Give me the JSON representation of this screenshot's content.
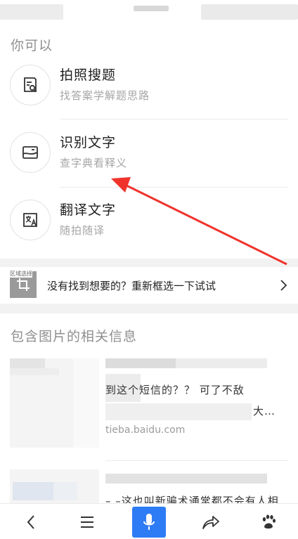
{
  "section_you_can": "你可以",
  "options": [
    {
      "title": "拍照搜题",
      "subtitle": "找答案学解题思路"
    },
    {
      "title": "识别文字",
      "subtitle": "查字典看释义"
    },
    {
      "title": "翻译文字",
      "subtitle": "随拍随译"
    }
  ],
  "reselect": {
    "thumb_tag": "区域选择",
    "text": "没有找到想要的？重新框选一下试试"
  },
  "section_related": "包含图片的相关信息",
  "results": [
    {
      "line1": "到这个短信的？？ 可了不敌",
      "line2": "大…",
      "source": "tieba.baidu.com"
    },
    {
      "line1": "– –这也叫新骗术通常都不会有人相",
      "line2": "",
      "source": ""
    }
  ],
  "colors": {
    "accent": "#2d7cf6",
    "arrow": "#f0342c"
  }
}
